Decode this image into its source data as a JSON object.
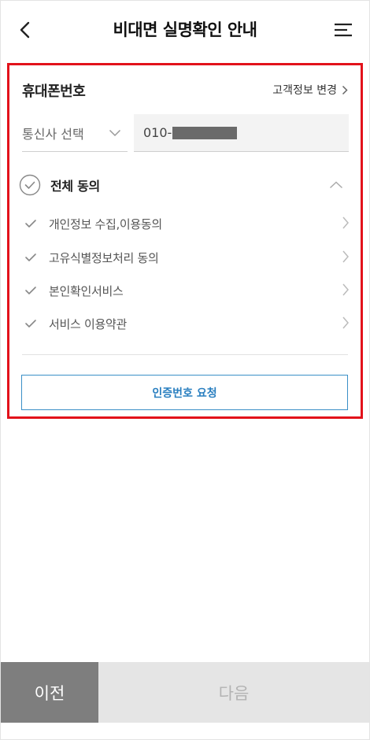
{
  "header": {
    "title": "비대면 실명확인 안내",
    "back_icon": "chevron-left-icon",
    "menu_icon": "hamburger-menu-icon"
  },
  "phone_section": {
    "title": "휴대폰번호",
    "change_link": "고객정보 변경",
    "carrier_placeholder": "통신사 선택",
    "phone_prefix": "010-"
  },
  "agreements": {
    "all_label": "전체 동의",
    "items": [
      {
        "label": "개인정보 수집,이용동의"
      },
      {
        "label": "고유식별정보처리 동의"
      },
      {
        "label": "본인확인서비스"
      },
      {
        "label": "서비스 이용약관"
      }
    ]
  },
  "request_button": "인증번호 요청",
  "footer": {
    "prev": "이전",
    "next": "다음"
  },
  "colors": {
    "highlight": "#e2121b",
    "accent": "#2a7fc0",
    "prev_bg": "#7e7e7e",
    "next_bg": "#e5e5e5"
  }
}
